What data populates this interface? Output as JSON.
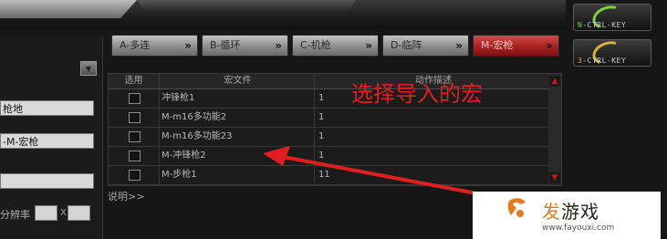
{
  "tabs": [
    {
      "label": "A-多连",
      "chevron": "»"
    },
    {
      "label": "B-循环",
      "chevron": "»"
    },
    {
      "label": "C-机枪",
      "chevron": "»"
    },
    {
      "label": "D-临阵",
      "chevron": "»"
    },
    {
      "label": "M-宏枪",
      "chevron": "»",
      "active": true
    }
  ],
  "keys": [
    {
      "label_first": "N",
      "label_rest": "-CTRL-KEY",
      "color": "#7bd437"
    },
    {
      "label_first": "3",
      "label_rest": "-CTRL-KEY",
      "color": "#d4b437"
    }
  ],
  "left_panel": {
    "field1": "枪地",
    "field2": "-M-宏枪",
    "field3": "",
    "resolution_label": "分辨率",
    "x_sep": "X",
    "collapse_icon": "▼"
  },
  "table": {
    "headers": [
      "选用",
      "宏文件",
      "动作描述"
    ],
    "rows": [
      {
        "file": "冲锋枪1",
        "desc": "1"
      },
      {
        "file": "M-m16多功能2",
        "desc": "1"
      },
      {
        "file": "M-m16多功能23",
        "desc": "1"
      },
      {
        "file": "M-冲锋枪2",
        "desc": "1"
      },
      {
        "file": "M-步枪1",
        "desc": "11"
      }
    ],
    "explain": "说明>>"
  },
  "annotation": "选择导入的宏",
  "watermark": {
    "title_accent": "发",
    "title_rest": "游戏",
    "url": "www.fayouxi.com"
  },
  "colors": {
    "accent_red": "#e02020",
    "active_tab": "#a82222",
    "watermark_orange": "#e8791c"
  }
}
